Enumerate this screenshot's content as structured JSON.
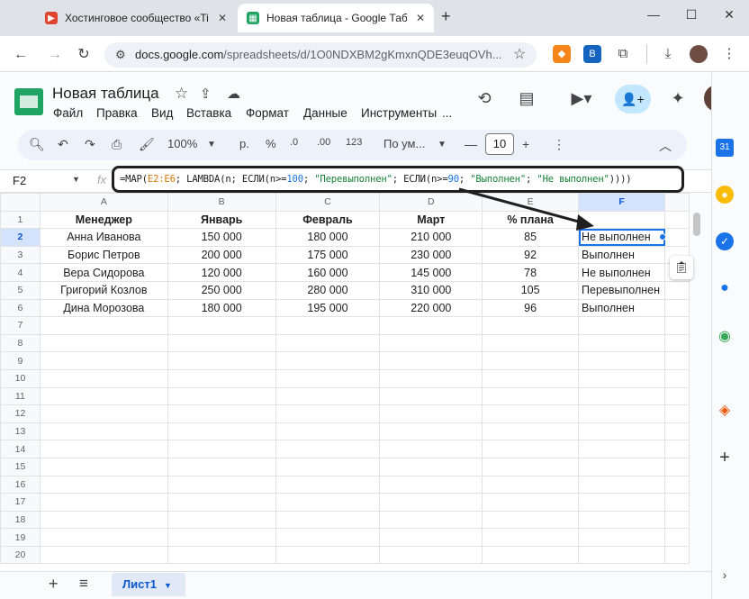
{
  "browser": {
    "tabs": [
      {
        "label": "Хостинговое сообщество «Tim",
        "active": false
      },
      {
        "label": "Новая таблица - Google Табли",
        "active": true
      }
    ],
    "new_tab": "+",
    "url_host": "docs.google.com",
    "url_path": "/spreadsheets/d/1O0NDXBM2gKmxnQDE3euqOVh..."
  },
  "doc": {
    "title": "Новая таблица",
    "menu": [
      "Файл",
      "Правка",
      "Вид",
      "Вставка",
      "Формат",
      "Данные",
      "Инструменты",
      "..."
    ]
  },
  "toolbar": {
    "zoom": "100%",
    "currency_p": "р.",
    "percent": "%",
    "dec_less": ".0",
    "dec_more": ".00",
    "num": "123",
    "font": "По ум...",
    "font_size": "10"
  },
  "formula_bar": {
    "cell_ref": "F2",
    "fx": "fx",
    "formula_parts": [
      {
        "t": "=MAP(",
        "c": ""
      },
      {
        "t": "E2:E6",
        "c": "fr"
      },
      {
        "t": "; LAMBDA(n; ЕСЛИ(n>=",
        "c": ""
      },
      {
        "t": "100",
        "c": "fn"
      },
      {
        "t": "; ",
        "c": ""
      },
      {
        "t": "\"Перевыполнен\"",
        "c": "fs"
      },
      {
        "t": "; ЕСЛИ(n>=",
        "c": ""
      },
      {
        "t": "90",
        "c": "fn"
      },
      {
        "t": "; ",
        "c": ""
      },
      {
        "t": "\"Выполнен\"",
        "c": "fs"
      },
      {
        "t": "; ",
        "c": ""
      },
      {
        "t": "\"Не выполнен\"",
        "c": "fs"
      },
      {
        "t": "))))",
        "c": ""
      }
    ]
  },
  "sheet": {
    "columns": [
      "A",
      "B",
      "C",
      "D",
      "E",
      "F"
    ],
    "row_numbers": [
      "1",
      "2",
      "3",
      "4",
      "5",
      "6",
      "7",
      "8",
      "9",
      "10",
      "11",
      "12",
      "13",
      "14",
      "15",
      "16",
      "17",
      "18",
      "19",
      "20"
    ],
    "header": [
      "Менеджер",
      "Январь",
      "Февраль",
      "Март",
      "% плана",
      ""
    ],
    "rows": [
      [
        "Анна Иванова",
        "150 000",
        "180 000",
        "210 000",
        "85",
        "Не выполнен"
      ],
      [
        "Борис Петров",
        "200 000",
        "175 000",
        "230 000",
        "92",
        "Выполнен"
      ],
      [
        "Вера Сидорова",
        "120 000",
        "160 000",
        "145 000",
        "78",
        "Не выполнен"
      ],
      [
        "Григорий Козлов",
        "250 000",
        "280 000",
        "310 000",
        "105",
        "Перевыполнен"
      ],
      [
        "Дина Морозова",
        "180 000",
        "195 000",
        "220 000",
        "96",
        "Выполнен"
      ]
    ],
    "active_cell": "F2"
  },
  "sheet_tabs": {
    "add": "+",
    "list": "≡",
    "active": "Лист1"
  },
  "side_panel": {
    "calendar_day": "31",
    "add": "+"
  }
}
